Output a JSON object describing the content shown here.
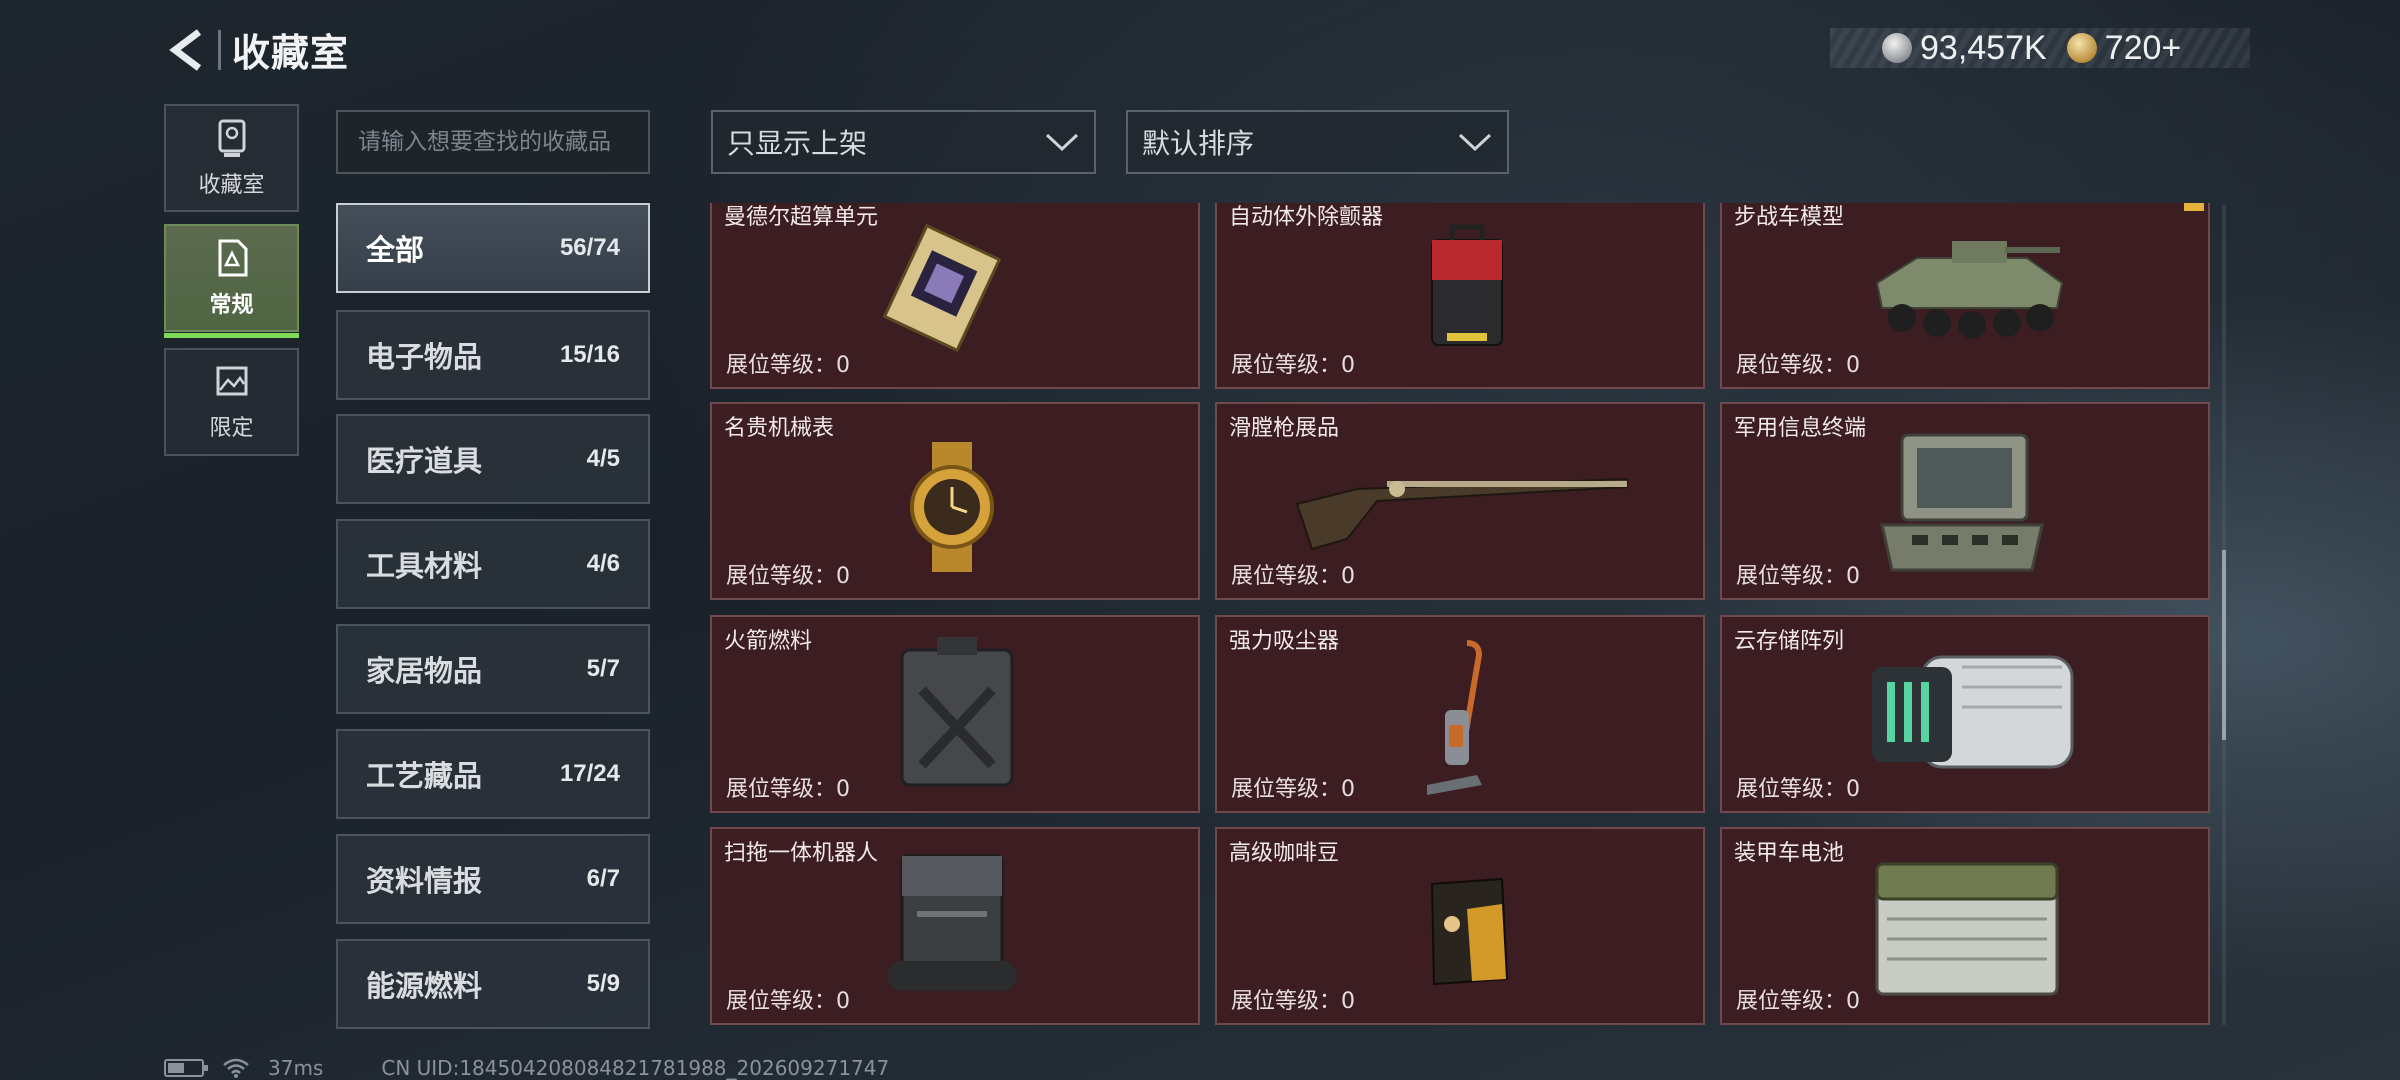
{
  "header": {
    "title": "收藏室"
  },
  "currency": [
    {
      "icon": "silver-coin-icon",
      "value": "93,457K"
    },
    {
      "icon": "gold-coin-icon",
      "value": "720+"
    }
  ],
  "nav": [
    {
      "label": "收藏室",
      "icon": "trophy-icon",
      "active": false
    },
    {
      "label": "常规",
      "icon": "document-icon",
      "active": true
    },
    {
      "label": "限定",
      "icon": "picture-icon",
      "active": false
    }
  ],
  "search": {
    "placeholder": "请输入想要查找的收藏品"
  },
  "filters": {
    "display": "只显示上架",
    "sort": "默认排序"
  },
  "categories": [
    {
      "name": "全部",
      "count": "56/74",
      "active": true
    },
    {
      "name": "电子物品",
      "count": "15/16"
    },
    {
      "name": "医疗道具",
      "count": "4/5"
    },
    {
      "name": "工具材料",
      "count": "4/6"
    },
    {
      "name": "家居物品",
      "count": "5/7"
    },
    {
      "name": "工艺藏品",
      "count": "17/24"
    },
    {
      "name": "资料情报",
      "count": "6/7"
    },
    {
      "name": "能源燃料",
      "count": "5/9"
    }
  ],
  "items": [
    {
      "name": "曼德尔超算单元",
      "level": "展位等级：0",
      "art": "chip"
    },
    {
      "name": "自动体外除颤器",
      "level": "展位等级：0",
      "art": "defib"
    },
    {
      "name": "步战车模型",
      "level": "展位等级：0",
      "art": "tank"
    },
    {
      "name": "名贵机械表",
      "level": "展位等级：0",
      "art": "watch"
    },
    {
      "name": "滑膛枪展品",
      "level": "展位等级：0",
      "art": "musket"
    },
    {
      "name": "军用信息终端",
      "level": "展位等级：0",
      "art": "terminal"
    },
    {
      "name": "火箭燃料",
      "level": "展位等级：0",
      "art": "jerrycan"
    },
    {
      "name": "强力吸尘器",
      "level": "展位等级：0",
      "art": "vacuum"
    },
    {
      "name": "云存储阵列",
      "level": "展位等级：0",
      "art": "storage"
    },
    {
      "name": "扫拖一体机器人",
      "level": "展位等级：0",
      "art": "robot"
    },
    {
      "name": "高级咖啡豆",
      "level": "展位等级：0",
      "art": "coffee"
    },
    {
      "name": "装甲车电池",
      "level": "展位等级：0",
      "art": "battery"
    }
  ],
  "status": {
    "ping": "37ms",
    "uid": "CN UID:184504208084821781988_202609271747"
  }
}
